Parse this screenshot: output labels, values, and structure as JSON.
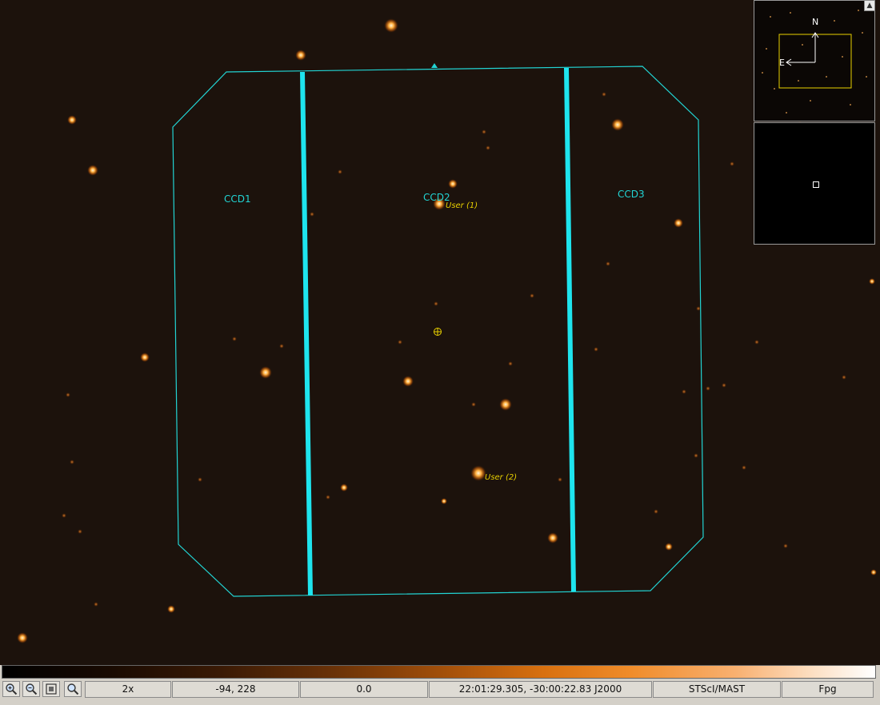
{
  "image": {
    "apertures": [
      {
        "label": "CCD1"
      },
      {
        "label": "CCD2"
      },
      {
        "label": "CCD3"
      }
    ],
    "user_markers": [
      {
        "label": "User (1)"
      },
      {
        "label": "User (2)"
      }
    ]
  },
  "panner": {
    "north_label": "N",
    "east_label": "E"
  },
  "toolbar": {
    "tools": [
      {
        "name": "zoom-in-icon"
      },
      {
        "name": "zoom-out-icon"
      },
      {
        "name": "zoom-fit-icon"
      },
      {
        "name": "zoom-actual-icon"
      }
    ]
  },
  "status": {
    "zoom": "2x",
    "pixel_coords": "-94, 228",
    "pixel_value": "0.0",
    "wcs": "22:01:29.305, -30:00:22.83 J2000",
    "source": "STScI/MAST",
    "band": "Fpg"
  },
  "colors": {
    "aperture": "#22d4d4",
    "marker": "#e8d000",
    "star": "#ff9a2a"
  }
}
